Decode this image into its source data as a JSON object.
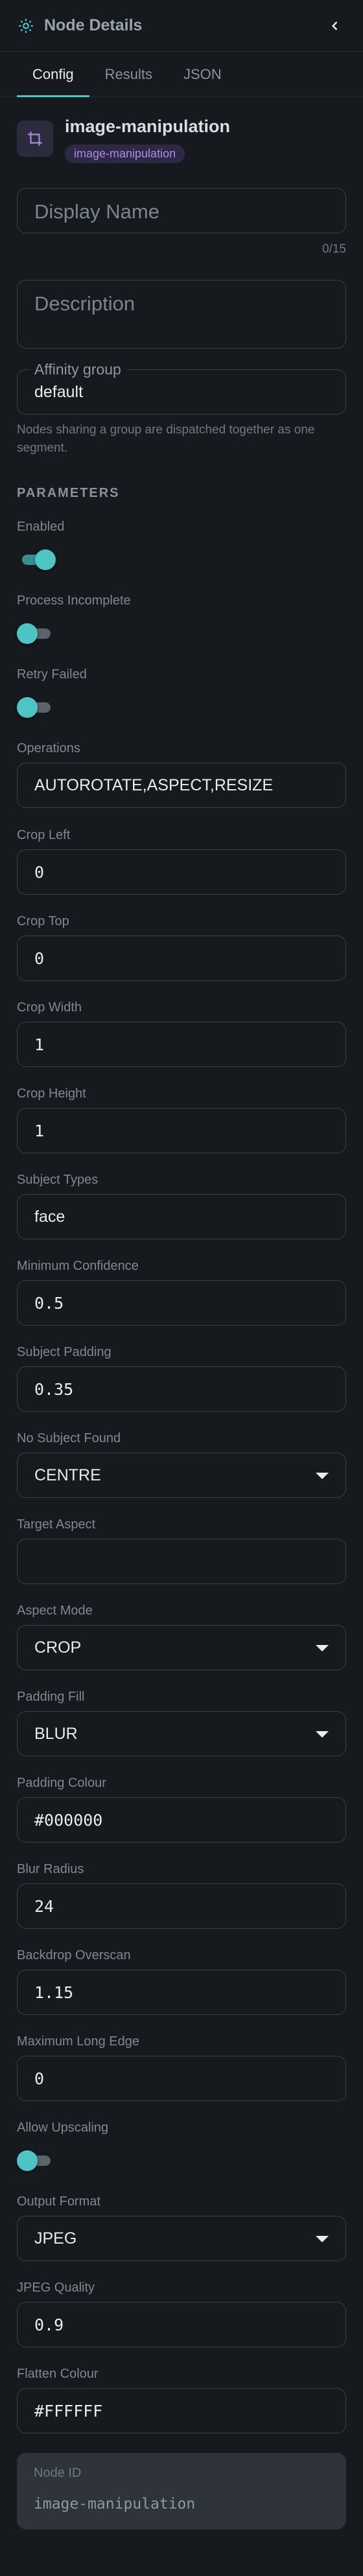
{
  "header": {
    "title": "Node Details",
    "icon": "gear-icon",
    "collapse_icon": "chevron-left-icon"
  },
  "tabs": [
    {
      "label": "Config",
      "active": true
    },
    {
      "label": "Results",
      "active": false
    },
    {
      "label": "JSON",
      "active": false
    }
  ],
  "node": {
    "name": "image-manipulation",
    "badge": "image-manipulation",
    "icon": "crop-icon"
  },
  "display_name": {
    "placeholder": "Display Name",
    "counter": "0/15"
  },
  "description": {
    "placeholder": "Description"
  },
  "affinity": {
    "label": "Affinity group",
    "value": "default",
    "helper": "Nodes sharing a group are dispatched together as one segment."
  },
  "parameters": {
    "heading": "PARAMETERS",
    "enabled": {
      "label": "Enabled",
      "on": true
    },
    "process_incomplete": {
      "label": "Process Incomplete",
      "on": false
    },
    "retry_failed": {
      "label": "Retry Failed",
      "on": false
    },
    "operations": {
      "label": "Operations",
      "value": "AUTOROTATE,ASPECT,RESIZE"
    },
    "crop_left": {
      "label": "Crop Left",
      "value": "0"
    },
    "crop_top": {
      "label": "Crop Top",
      "value": "0"
    },
    "crop_width": {
      "label": "Crop Width",
      "value": "1"
    },
    "crop_height": {
      "label": "Crop Height",
      "value": "1"
    },
    "subject_types": {
      "label": "Subject Types",
      "value": "face"
    },
    "minimum_confidence": {
      "label": "Minimum Confidence",
      "value": "0.5"
    },
    "subject_padding": {
      "label": "Subject Padding",
      "value": "0.35"
    },
    "no_subject_found": {
      "label": "No Subject Found",
      "value": "CENTRE"
    },
    "target_aspect": {
      "label": "Target Aspect",
      "value": ""
    },
    "aspect_mode": {
      "label": "Aspect Mode",
      "value": "CROP"
    },
    "padding_fill": {
      "label": "Padding Fill",
      "value": "BLUR"
    },
    "padding_colour": {
      "label": "Padding Colour",
      "value": "#000000"
    },
    "blur_radius": {
      "label": "Blur Radius",
      "value": "24"
    },
    "backdrop_overscan": {
      "label": "Backdrop Overscan",
      "value": "1.15"
    },
    "maximum_long_edge": {
      "label": "Maximum Long Edge",
      "value": "0"
    },
    "allow_upscaling": {
      "label": "Allow Upscaling",
      "on": false
    },
    "output_format": {
      "label": "Output Format",
      "value": "JPEG"
    },
    "jpeg_quality": {
      "label": "JPEG Quality",
      "value": "0.9"
    },
    "flatten_colour": {
      "label": "Flatten Colour",
      "value": "#FFFFFF"
    }
  },
  "node_id": {
    "label": "Node ID",
    "value": "image-manipulation"
  },
  "colors": {
    "accent": "#4fc4c4",
    "background": "#16191d",
    "badge_bg": "#2e2844",
    "badge_text": "#a98be6"
  }
}
